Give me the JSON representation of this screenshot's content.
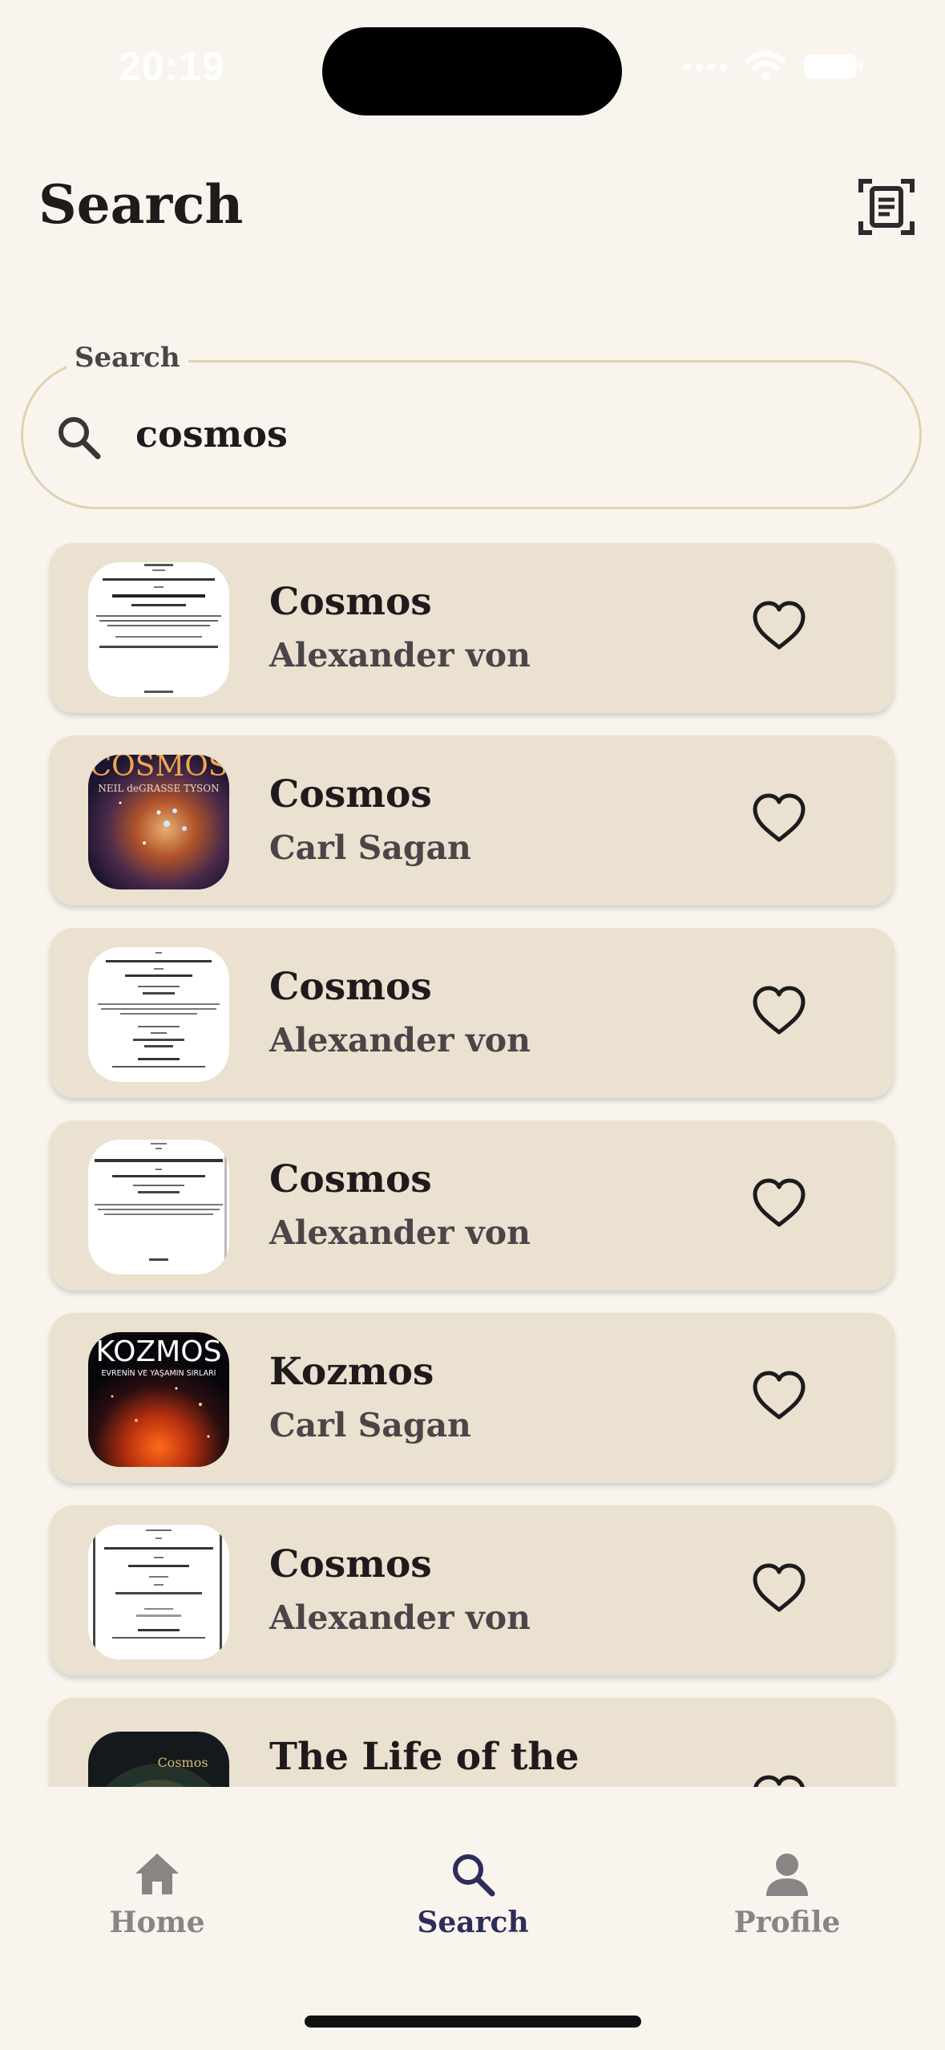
{
  "status_bar": {
    "time": "20:19"
  },
  "header": {
    "title": "Search"
  },
  "search": {
    "label": "Search",
    "value": "cosmos"
  },
  "results": [
    {
      "title": "Cosmos",
      "author": "Alexander von"
    },
    {
      "title": "Cosmos",
      "author": "Carl Sagan"
    },
    {
      "title": "Cosmos",
      "author": "Alexander von"
    },
    {
      "title": "Cosmos",
      "author": "Alexander von"
    },
    {
      "title": "Kozmos",
      "author": "Carl Sagan"
    },
    {
      "title": "Cosmos",
      "author": "Alexander von"
    },
    {
      "title": "The Life of the",
      "author": ""
    }
  ],
  "covers": {
    "carl_sagan_cosmos": {
      "title": "COSMOS",
      "subtitle": "NEIL deGRASSE TYSON"
    },
    "kozmos": {
      "title": "KOZMOS",
      "subtitle": "EVRENİN VE YAŞAMIN SIRLARI"
    },
    "life": {
      "title": "Cosmos"
    }
  },
  "nav": {
    "home": "Home",
    "search": "Search",
    "profile": "Profile"
  },
  "colors": {
    "background": "#f9f5ee",
    "card": "#ebe1d0",
    "nav_active": "#2e2c5c",
    "nav_inactive": "#8a8585"
  }
}
